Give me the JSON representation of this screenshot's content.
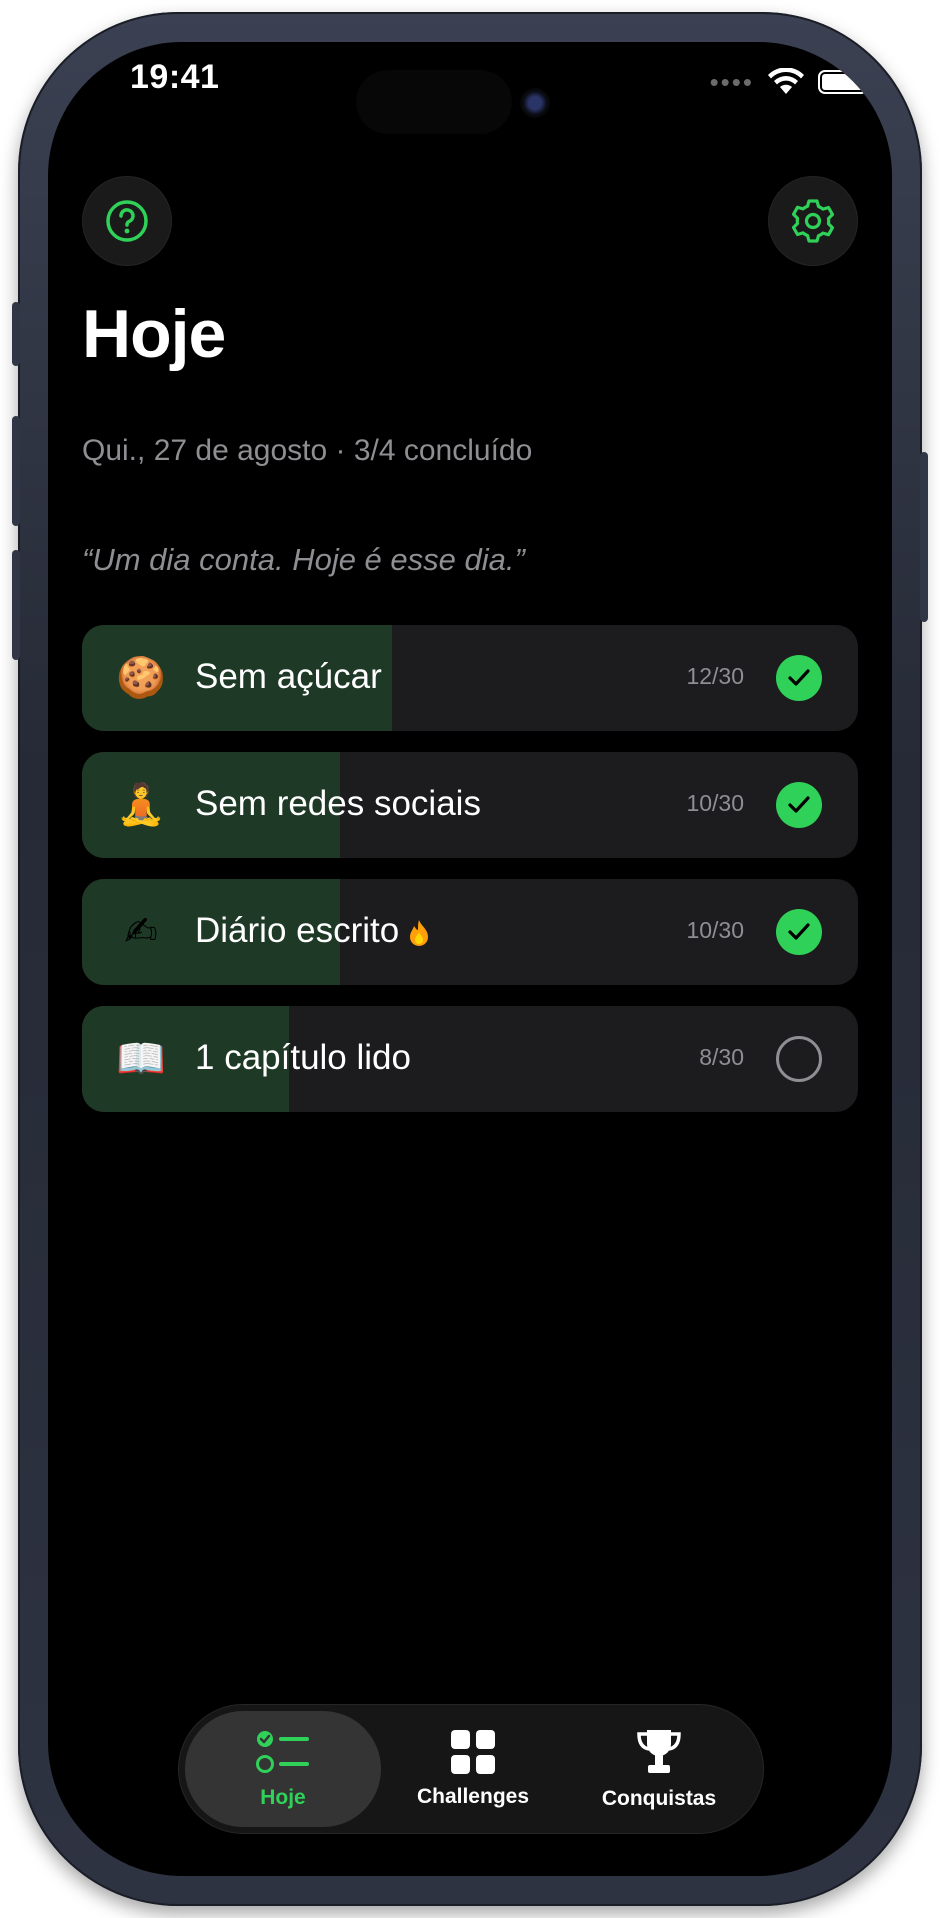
{
  "status_bar": {
    "time": "19:41"
  },
  "header": {
    "title": "Hoje",
    "subtitle": "Qui., 27 de agosto · 3/4 concluído",
    "quote": "“Um dia conta. Hoje é esse dia.”"
  },
  "icons": {
    "help": "help-circle-icon",
    "settings": "gear-icon"
  },
  "colors": {
    "accent": "#30d158",
    "progress": "#1e3a27",
    "card": "#1c1c1e",
    "muted": "#8e8e93"
  },
  "habits": [
    {
      "emoji": "🍪",
      "name": "Sem açúcar",
      "count": "12/30",
      "progress": 0.4,
      "done": true,
      "streak": false
    },
    {
      "emoji": "🧘",
      "name": "Sem redes sociais",
      "count": "10/30",
      "progress": 0.333,
      "done": true,
      "streak": false
    },
    {
      "emoji": "✍",
      "name": "Diário escrito",
      "count": "10/30",
      "progress": 0.333,
      "done": true,
      "streak": true
    },
    {
      "emoji": "📖",
      "name": "1 capítulo lido",
      "count": "8/30",
      "progress": 0.267,
      "done": false,
      "streak": false
    }
  ],
  "tabs": [
    {
      "label": "Hoje",
      "active": true
    },
    {
      "label": "Challenges",
      "active": false
    },
    {
      "label": "Conquistas",
      "active": false
    }
  ]
}
